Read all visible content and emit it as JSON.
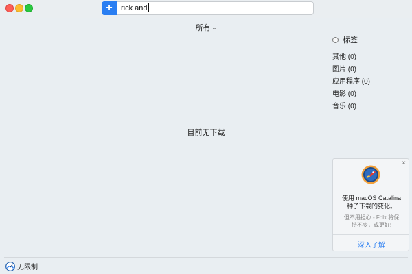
{
  "window": {
    "search": {
      "value": "rick and",
      "placeholder": ""
    },
    "add_button_label": "+"
  },
  "filter": {
    "label": "所有",
    "chevron": "⌄"
  },
  "main": {
    "empty_message": "目前无下载"
  },
  "sidebar": {
    "tags_label": "标签",
    "categories": [
      {
        "label": "其他 (0)"
      },
      {
        "label": "图片 (0)"
      },
      {
        "label": "应用程序 (0)"
      },
      {
        "label": "电影 (0)"
      },
      {
        "label": "音乐 (0)"
      }
    ]
  },
  "promo": {
    "close_label": "×",
    "title_line1": "使用 macOS Catalina",
    "title_line2": "种子下载的变化。",
    "subtitle_line1": "但不用担心 - Folx 将保",
    "subtitle_line2": "持不变，或更好!",
    "link_label": "深入了解",
    "icon": "folx-rocket-icon"
  },
  "footer": {
    "speed_label": "无限制",
    "icon": "speedometer-icon"
  },
  "colors": {
    "accent": "#2a7ef2",
    "background": "#e9eef2"
  }
}
